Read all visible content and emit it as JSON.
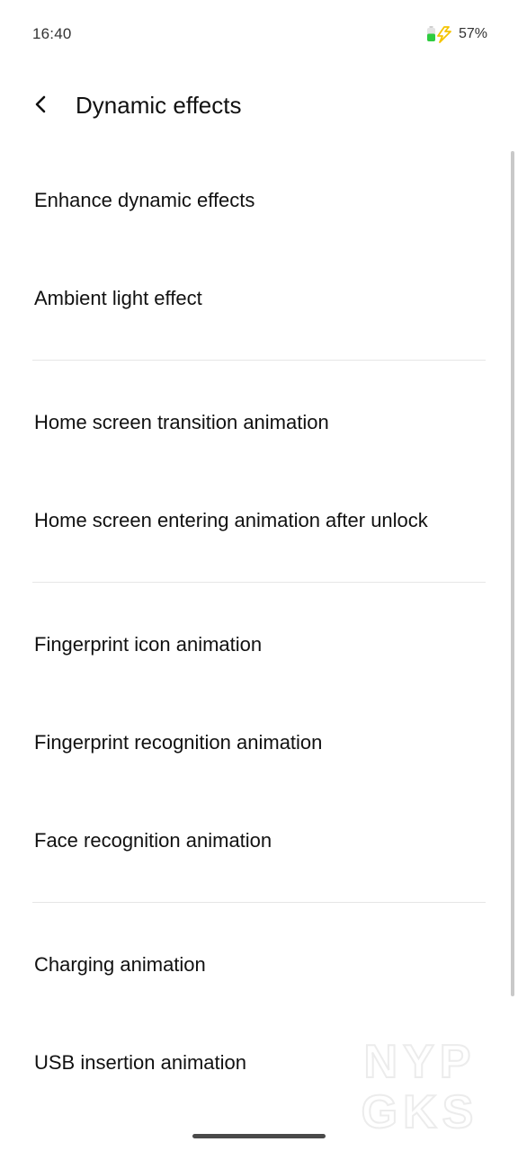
{
  "status_bar": {
    "time": "16:40",
    "battery_percent": "57%",
    "battery_icon": "battery-charging-icon",
    "battery_level": 0.57,
    "battery_color": "#2ecc40",
    "charging_bolt_color": "#f5c400"
  },
  "header": {
    "back_icon": "chevron-left-icon",
    "title": "Dynamic effects"
  },
  "groups": [
    [
      "Enhance dynamic effects",
      "Ambient light effect"
    ],
    [
      "Home screen transition animation",
      "Home screen entering animation after unlock"
    ],
    [
      "Fingerprint icon animation",
      "Fingerprint recognition animation",
      "Face recognition animation"
    ],
    [
      "Charging animation",
      "USB insertion animation"
    ]
  ],
  "watermark": {
    "line1": "NYP",
    "line2": "GKS"
  }
}
